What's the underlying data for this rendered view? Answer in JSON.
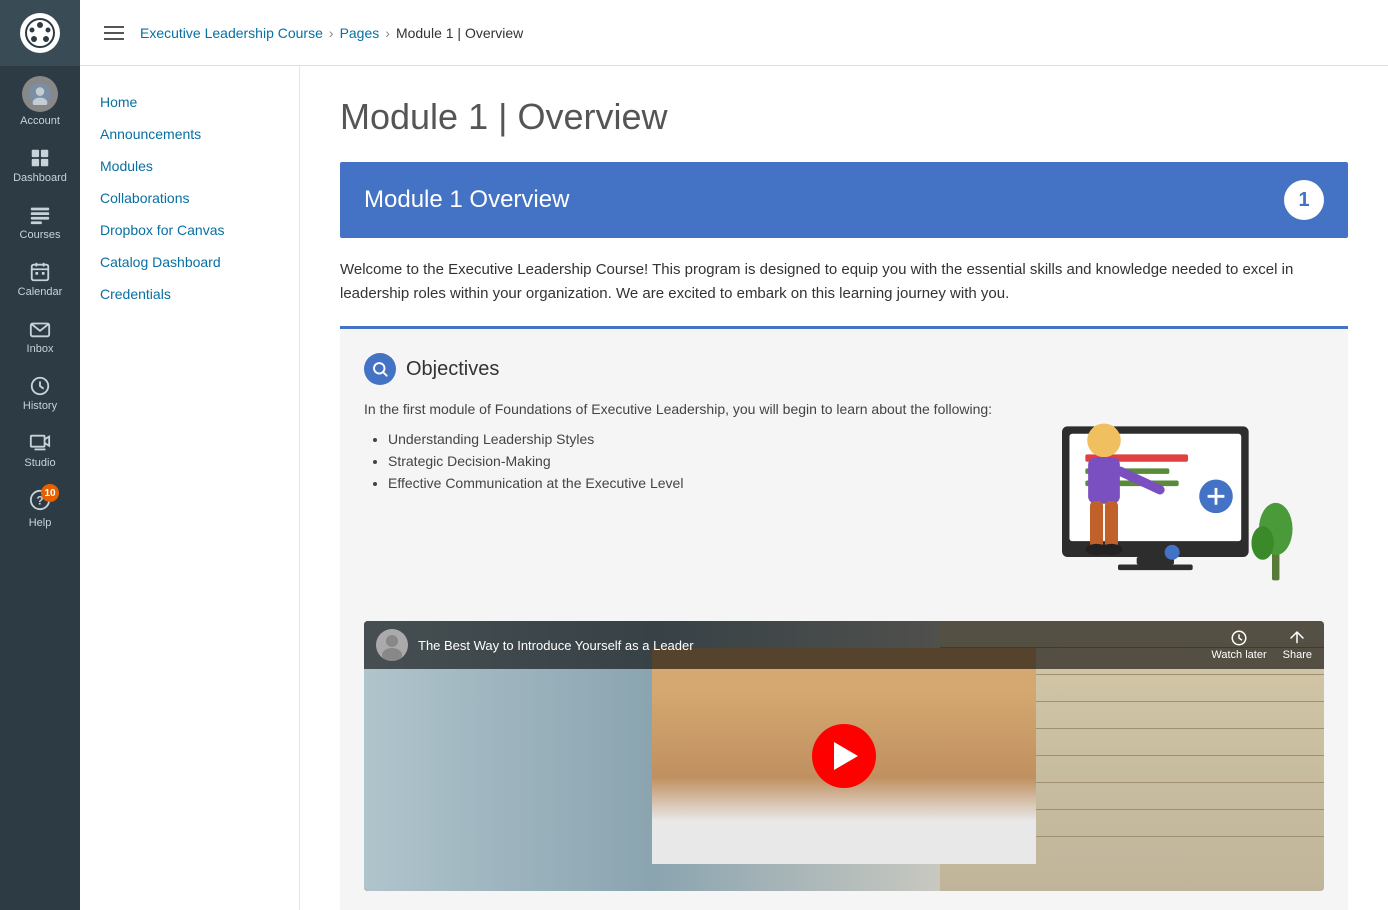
{
  "sidebar": {
    "logo_alt": "Canvas LMS Logo",
    "items": [
      {
        "id": "account",
        "label": "Account",
        "icon": "account-icon"
      },
      {
        "id": "dashboard",
        "label": "Dashboard",
        "icon": "dashboard-icon"
      },
      {
        "id": "courses",
        "label": "Courses",
        "icon": "courses-icon"
      },
      {
        "id": "calendar",
        "label": "Calendar",
        "icon": "calendar-icon"
      },
      {
        "id": "inbox",
        "label": "Inbox",
        "icon": "inbox-icon"
      },
      {
        "id": "history",
        "label": "History",
        "icon": "history-icon"
      },
      {
        "id": "studio",
        "label": "Studio",
        "icon": "studio-icon"
      },
      {
        "id": "help",
        "label": "Help",
        "icon": "help-icon",
        "badge": "10"
      }
    ]
  },
  "topbar": {
    "menu_label": "Menu",
    "breadcrumb": [
      {
        "label": "Executive Leadership Course",
        "href": "#"
      },
      {
        "label": "Pages",
        "href": "#"
      },
      {
        "label": "Module 1 | Overview",
        "current": true
      }
    ]
  },
  "left_nav": {
    "items": [
      {
        "label": "Home",
        "href": "#"
      },
      {
        "label": "Announcements",
        "href": "#"
      },
      {
        "label": "Modules",
        "href": "#"
      },
      {
        "label": "Collaborations",
        "href": "#"
      },
      {
        "label": "Dropbox for Canvas",
        "href": "#"
      },
      {
        "label": "Catalog Dashboard",
        "href": "#"
      },
      {
        "label": "Credentials",
        "href": "#"
      }
    ]
  },
  "page": {
    "title": "Module 1 | Overview",
    "banner": {
      "heading": "Module 1 Overview",
      "number": "1"
    },
    "welcome_text": "Welcome to the Executive Leadership Course! This program is designed to equip you with the essential skills and knowledge needed to excel in leadership roles within your organization. We are excited to embark on this learning journey with you.",
    "objectives": {
      "title": "Objectives",
      "description": "In the first module of Foundations of Executive Leadership, you will begin to learn about the following:",
      "items": [
        "Understanding Leadership Styles",
        "Strategic Decision-Making",
        "Effective Communication at the Executive Level"
      ]
    },
    "video": {
      "title": "The Best Way to Introduce Yourself as a Leader",
      "watch_later": "Watch later",
      "share": "Share"
    }
  }
}
